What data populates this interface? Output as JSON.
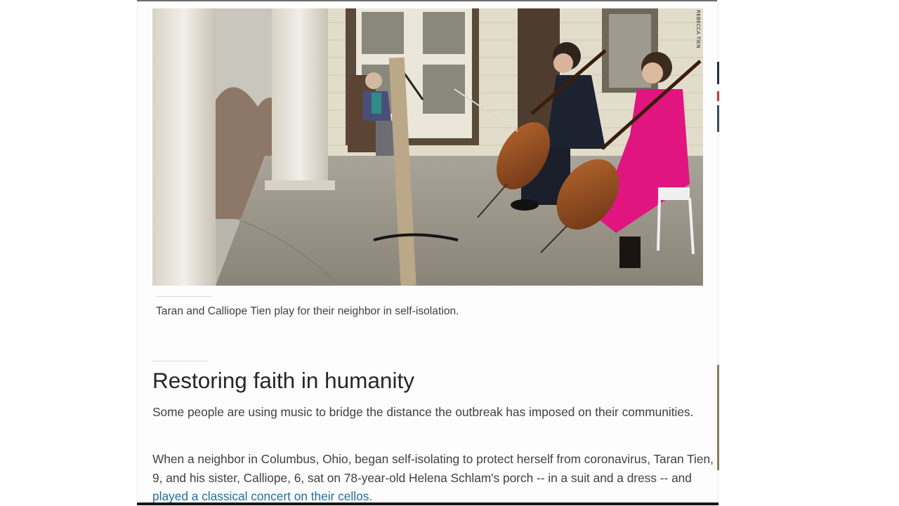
{
  "photo": {
    "alt": "Taran and Calliope Tien play for their neighbor in self-isolation.",
    "credit": "REBECCA TIEN"
  },
  "article": {
    "caption": "Taran and Calliope Tien play for their neighbor in self-isolation.",
    "section_title": "Restoring faith in humanity",
    "paragraph1": "Some people are using music to bridge the distance the outbreak has imposed on their communities.",
    "paragraph2_text": "When a neighbor in Columbus, Ohio, began self-isolating to protect herself from coronavirus, Taran Tien, 9, and his sister, Calliope, 6, sat on 78-year-old Helena Schlam's porch -- in a suit and a dress -- and ",
    "paragraph2_link": "played a classical concert on their cellos."
  },
  "colors": {
    "link": "#1f6f9f",
    "text": "#404040",
    "headline": "#262626"
  }
}
